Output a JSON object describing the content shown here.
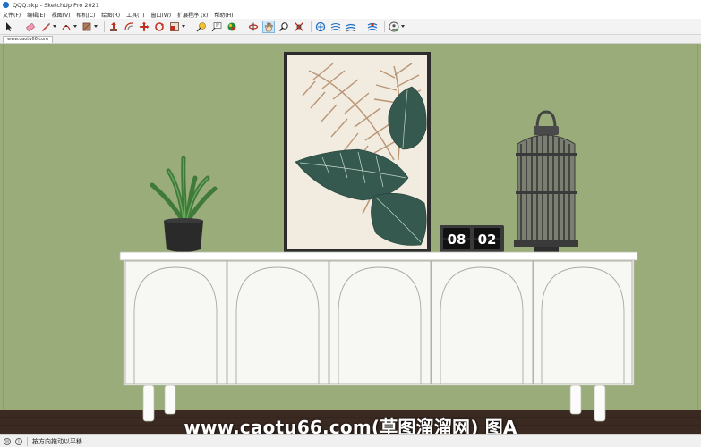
{
  "window": {
    "title": "QQQ.skp - SketchUp Pro 2021"
  },
  "menu": {
    "items": [
      "文件(F)",
      "编辑(E)",
      "视图(V)",
      "相机(C)",
      "绘图(R)",
      "工具(T)",
      "窗口(W)",
      "扩展程序 (x)",
      "帮助(H)"
    ]
  },
  "toolbar": {
    "active_tool": "orbit-icon"
  },
  "scene_tab": {
    "label": "www.caotu66.com"
  },
  "scene": {
    "clock_left": "08",
    "clock_right": "02",
    "wall_color": "#9aac79",
    "floor_color": "#3a2a22",
    "cabinet_color": "#ffffff",
    "watermark": "www.caotu66.com(草图溜溜网) 图A"
  },
  "statusbar": {
    "hint": "按方向拖动以平移"
  }
}
